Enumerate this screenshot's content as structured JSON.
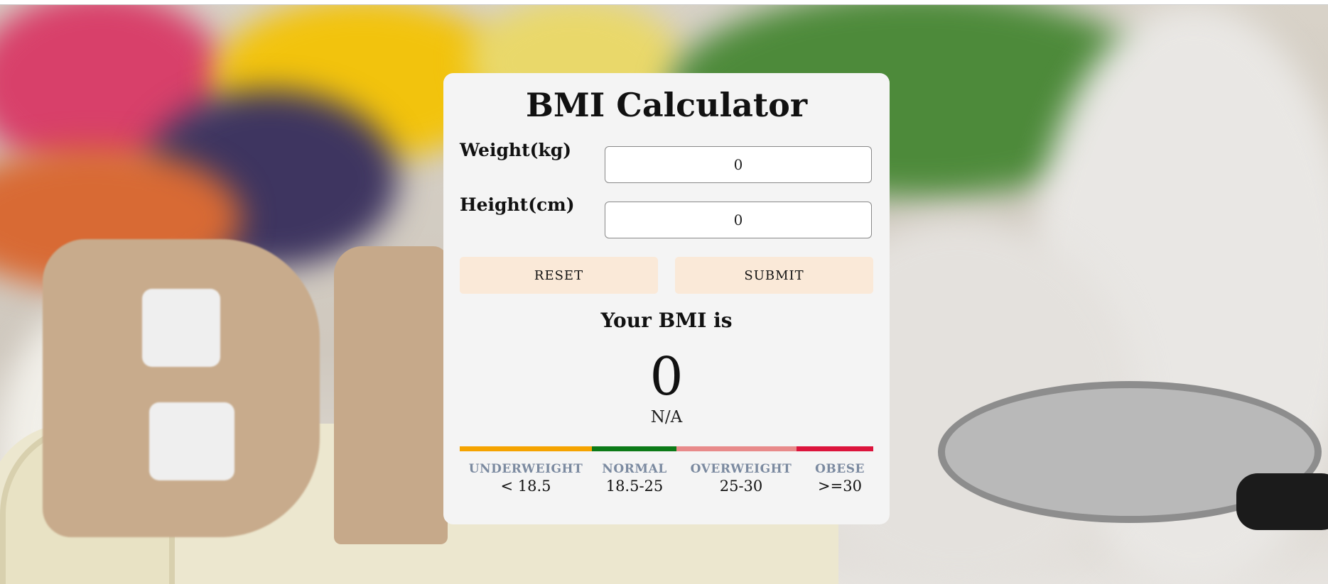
{
  "app": {
    "title": "BMI Calculator"
  },
  "form": {
    "weight_label": "Weight(kg)",
    "weight_value": "0",
    "height_label": "Height(cm)",
    "height_value": "0"
  },
  "buttons": {
    "reset_label": "RESET",
    "submit_label": "SUBMIT"
  },
  "result": {
    "heading": "Your BMI is",
    "value": "0",
    "status": "N/A"
  },
  "scale": {
    "categories": [
      {
        "name": "UNDERWEIGHT",
        "range": "< 18.5",
        "color": "#f5a300"
      },
      {
        "name": "NORMAL",
        "range": "18.5-25",
        "color": "#0c7a17"
      },
      {
        "name": "OVERWEIGHT",
        "range": "25-30",
        "color": "#e88a8a"
      },
      {
        "name": "OBESE",
        "range": ">=30",
        "color": "#dc143c"
      }
    ]
  },
  "colors": {
    "card_background": "#f4f4f4",
    "button_background": "#fae9d8",
    "legend_text": "#7b8aa0"
  }
}
